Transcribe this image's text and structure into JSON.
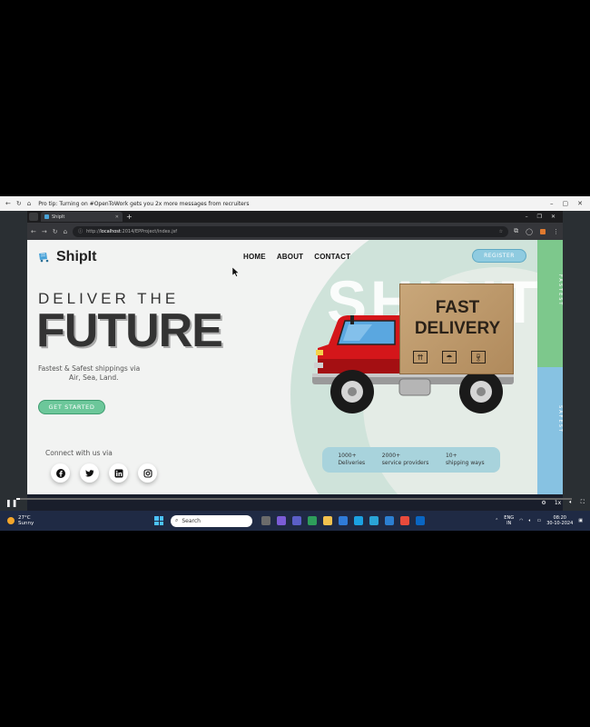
{
  "outer_bar": {
    "tip": "Pro tip: Turning on #OpenToWork gets you 2x more messages from recruiters"
  },
  "chrome": {
    "tab_title": "ShipIt",
    "url_prefix": "http://",
    "url_host": "localhost",
    "url_path": ":2014/EPProject/index.jsf"
  },
  "site": {
    "logo_text": "ShipIt",
    "nav": [
      "HOME",
      "ABOUT",
      "CONTACT"
    ],
    "register_label": "REGISTER",
    "bg_word": "SHIPIT",
    "headline_top": "DELIVER THE",
    "headline_main": "FUTURE",
    "tagline_line1": "Fastest & Safest shippings via",
    "tagline_line2": "Air, Sea, Land.",
    "cta_label": "GET STARTED",
    "connect_label": "Connect with us via",
    "box_line1": "FAST",
    "box_line2": "DELIVERY",
    "side_fast": "FASTEST",
    "side_safe": "SAFEST",
    "stats": [
      {
        "value": "1000+",
        "label": "Deliveries"
      },
      {
        "value": "2000+",
        "label": "service providers"
      },
      {
        "value": "10+",
        "label": "shipping ways"
      }
    ]
  },
  "player": {
    "speed": "1x"
  },
  "taskbar": {
    "temp": "27°C",
    "condition": "Sunny",
    "search_placeholder": "Search",
    "lang_line1": "ENG",
    "lang_line2": "IN",
    "time": "08:20",
    "date": "30-10-2024"
  },
  "colors": {
    "cta": "#6cc79a",
    "register": "#8fcbe0",
    "side_fast": "#7dc88c",
    "side_safe": "#87c2e2",
    "truck_cab": "#d4161a"
  }
}
